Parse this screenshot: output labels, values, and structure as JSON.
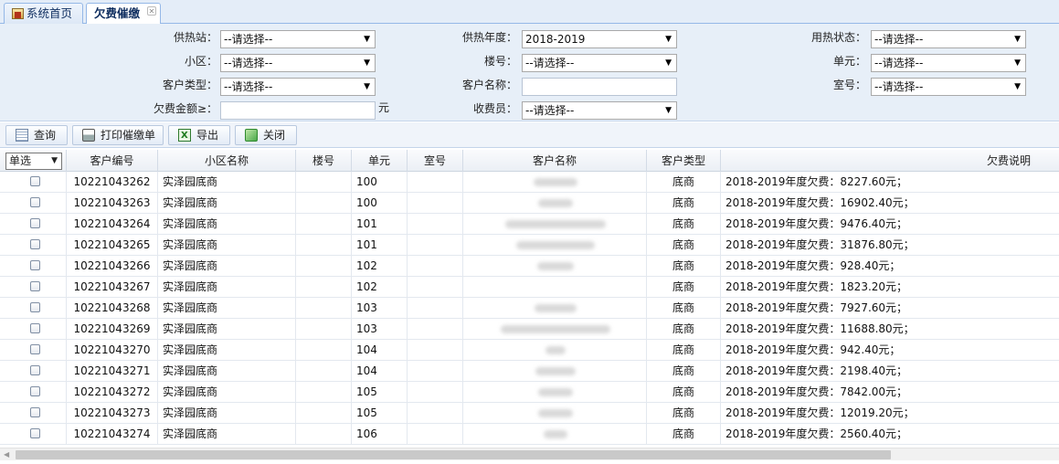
{
  "tabs": [
    {
      "label": "系统首页",
      "active": false
    },
    {
      "label": "欠费催缴",
      "active": true
    }
  ],
  "filters": {
    "heating_station": {
      "label": "供热站：",
      "value": "--请选择--"
    },
    "heating_year": {
      "label": "供热年度：",
      "value": "2018-2019"
    },
    "heat_status": {
      "label": "用热状态：",
      "value": "--请选择--"
    },
    "community": {
      "label": "小区：",
      "value": "--请选择--"
    },
    "building": {
      "label": "楼号：",
      "value": "--请选择--"
    },
    "unit": {
      "label": "单元：",
      "value": "--请选择--"
    },
    "customer_type": {
      "label": "客户类型：",
      "value": "--请选择--"
    },
    "customer_name": {
      "label": "客户名称：",
      "value": ""
    },
    "room": {
      "label": "室号：",
      "value": "--请选择--"
    },
    "arrears_amount": {
      "label": "欠费金额≥：",
      "value": "",
      "unit": "元"
    },
    "collector": {
      "label": "收费员：",
      "value": "--请选择--"
    }
  },
  "toolbar": {
    "query": "查询",
    "print": "打印催缴单",
    "export": "导出",
    "close": "关闭"
  },
  "grid": {
    "select_mode": "单选",
    "columns": [
      "客户编号",
      "小区名称",
      "楼号",
      "单元",
      "室号",
      "客户名称",
      "客户类型",
      "欠费说明"
    ],
    "rows": [
      {
        "id": "10221043262",
        "community": "实泽园底商",
        "building": "",
        "unit": "100",
        "room": "",
        "type": "底商",
        "desc": "2018-2019年度欠费：8227.60元；"
      },
      {
        "id": "10221043263",
        "community": "实泽园底商",
        "building": "",
        "unit": "100",
        "room": "",
        "type": "底商",
        "desc": "2018-2019年度欠费：16902.40元；"
      },
      {
        "id": "10221043264",
        "community": "实泽园底商",
        "building": "",
        "unit": "101",
        "room": "",
        "type": "底商",
        "desc": "2018-2019年度欠费：9476.40元；"
      },
      {
        "id": "10221043265",
        "community": "实泽园底商",
        "building": "",
        "unit": "101",
        "room": "",
        "type": "底商",
        "desc": "2018-2019年度欠费：31876.80元；"
      },
      {
        "id": "10221043266",
        "community": "实泽园底商",
        "building": "",
        "unit": "102",
        "room": "",
        "type": "底商",
        "desc": "2018-2019年度欠费：928.40元；"
      },
      {
        "id": "10221043267",
        "community": "实泽园底商",
        "building": "",
        "unit": "102",
        "room": "",
        "type": "底商",
        "desc": "2018-2019年度欠费：1823.20元；"
      },
      {
        "id": "10221043268",
        "community": "实泽园底商",
        "building": "",
        "unit": "103",
        "room": "",
        "type": "底商",
        "desc": "2018-2019年度欠费：7927.60元；"
      },
      {
        "id": "10221043269",
        "community": "实泽园底商",
        "building": "",
        "unit": "103",
        "room": "",
        "type": "底商",
        "desc": "2018-2019年度欠费：11688.80元；"
      },
      {
        "id": "10221043270",
        "community": "实泽园底商",
        "building": "",
        "unit": "104",
        "room": "",
        "type": "底商",
        "desc": "2018-2019年度欠费：942.40元；"
      },
      {
        "id": "10221043271",
        "community": "实泽园底商",
        "building": "",
        "unit": "104",
        "room": "",
        "type": "底商",
        "desc": "2018-2019年度欠费：2198.40元；"
      },
      {
        "id": "10221043272",
        "community": "实泽园底商",
        "building": "",
        "unit": "105",
        "room": "",
        "type": "底商",
        "desc": "2018-2019年度欠费：7842.00元；"
      },
      {
        "id": "10221043273",
        "community": "实泽园底商",
        "building": "",
        "unit": "105",
        "room": "",
        "type": "底商",
        "desc": "2018-2019年度欠费：12019.20元；"
      },
      {
        "id": "10221043274",
        "community": "实泽园底商",
        "building": "",
        "unit": "106",
        "room": "",
        "type": "底商",
        "desc": "2018-2019年度欠费：2560.40元；"
      }
    ]
  }
}
